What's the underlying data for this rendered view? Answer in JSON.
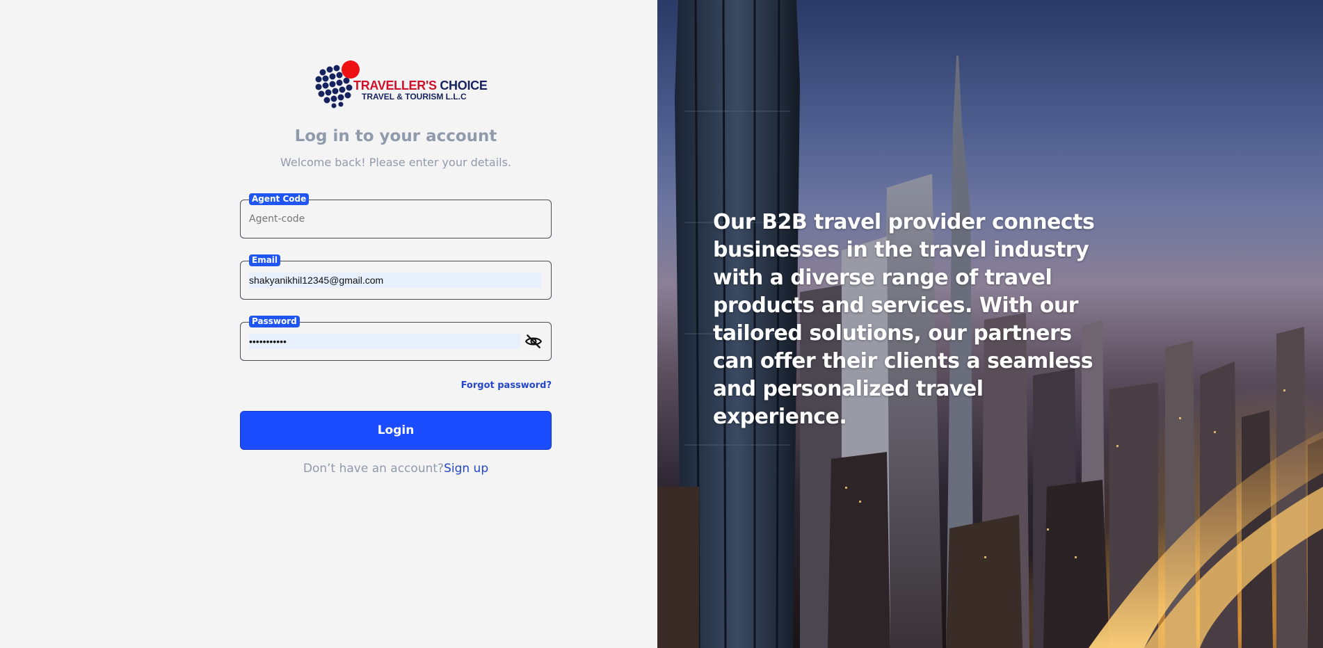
{
  "brand": {
    "line1_red": "TRAVELLER'S",
    "line1_navy": "CHOICE",
    "line2": "TRAVEL & TOURISM L.L.C",
    "logo_icon": "dotted-globe-logo",
    "colors": {
      "red": "#d0102a",
      "navy": "#15225e"
    }
  },
  "login": {
    "title": "Log in to your account",
    "subtitle": "Welcome back! Please enter your details.",
    "agent_code": {
      "label": "Agent Code",
      "value": "",
      "placeholder": "Agent-code"
    },
    "email": {
      "label": "Email",
      "value": "shakyanikhil12345@gmail.com"
    },
    "password": {
      "label": "Password",
      "value": "•••••••••••",
      "toggle_icon": "eye-off-icon"
    },
    "forgot_label": "Forgot password?",
    "login_label": "Login",
    "signup_prompt": "Don’t have an account?",
    "signup_label": "Sign up"
  },
  "hero": {
    "text": "Our B2B travel provider connects businesses in the travel industry with a diverse range of travel products and services. With our tailored solutions, our partners can offer their clients a seamless and personalized travel experience."
  },
  "colors": {
    "accent": "#1b4dff",
    "label_bg": "#1f55f0",
    "link": "#2347c8",
    "muted_text": "#8f9aab",
    "page_bg": "#f4f4f5"
  }
}
